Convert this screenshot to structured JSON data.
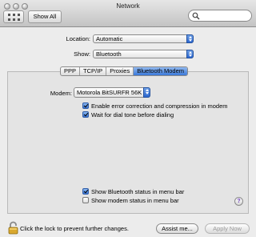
{
  "window": {
    "title": "Network"
  },
  "toolbar": {
    "show_all_label": "Show All",
    "search_placeholder": ""
  },
  "location": {
    "label": "Location:",
    "value": "Automatic"
  },
  "show": {
    "label": "Show:",
    "value": "Bluetooth"
  },
  "tabs": [
    {
      "label": "PPP",
      "active": false
    },
    {
      "label": "TCP/IP",
      "active": false
    },
    {
      "label": "Proxies",
      "active": false
    },
    {
      "label": "Bluetooth Modem",
      "active": true
    }
  ],
  "modem": {
    "label": "Modem:",
    "value": "Motorola BitSURFR 56K"
  },
  "options": [
    {
      "label": "Enable error correction and compression in modem",
      "checked": true
    },
    {
      "label": "Wait for dial tone before dialing",
      "checked": true
    },
    {
      "label": "Show Bluetooth status in menu bar",
      "checked": true
    },
    {
      "label": "Show modem status in menu bar",
      "checked": false
    }
  ],
  "footer": {
    "lock_text": "Click the lock to prevent further changes.",
    "assist_label": "Assist me...",
    "apply_label": "Apply Now"
  },
  "help": {
    "symbol": "?"
  }
}
